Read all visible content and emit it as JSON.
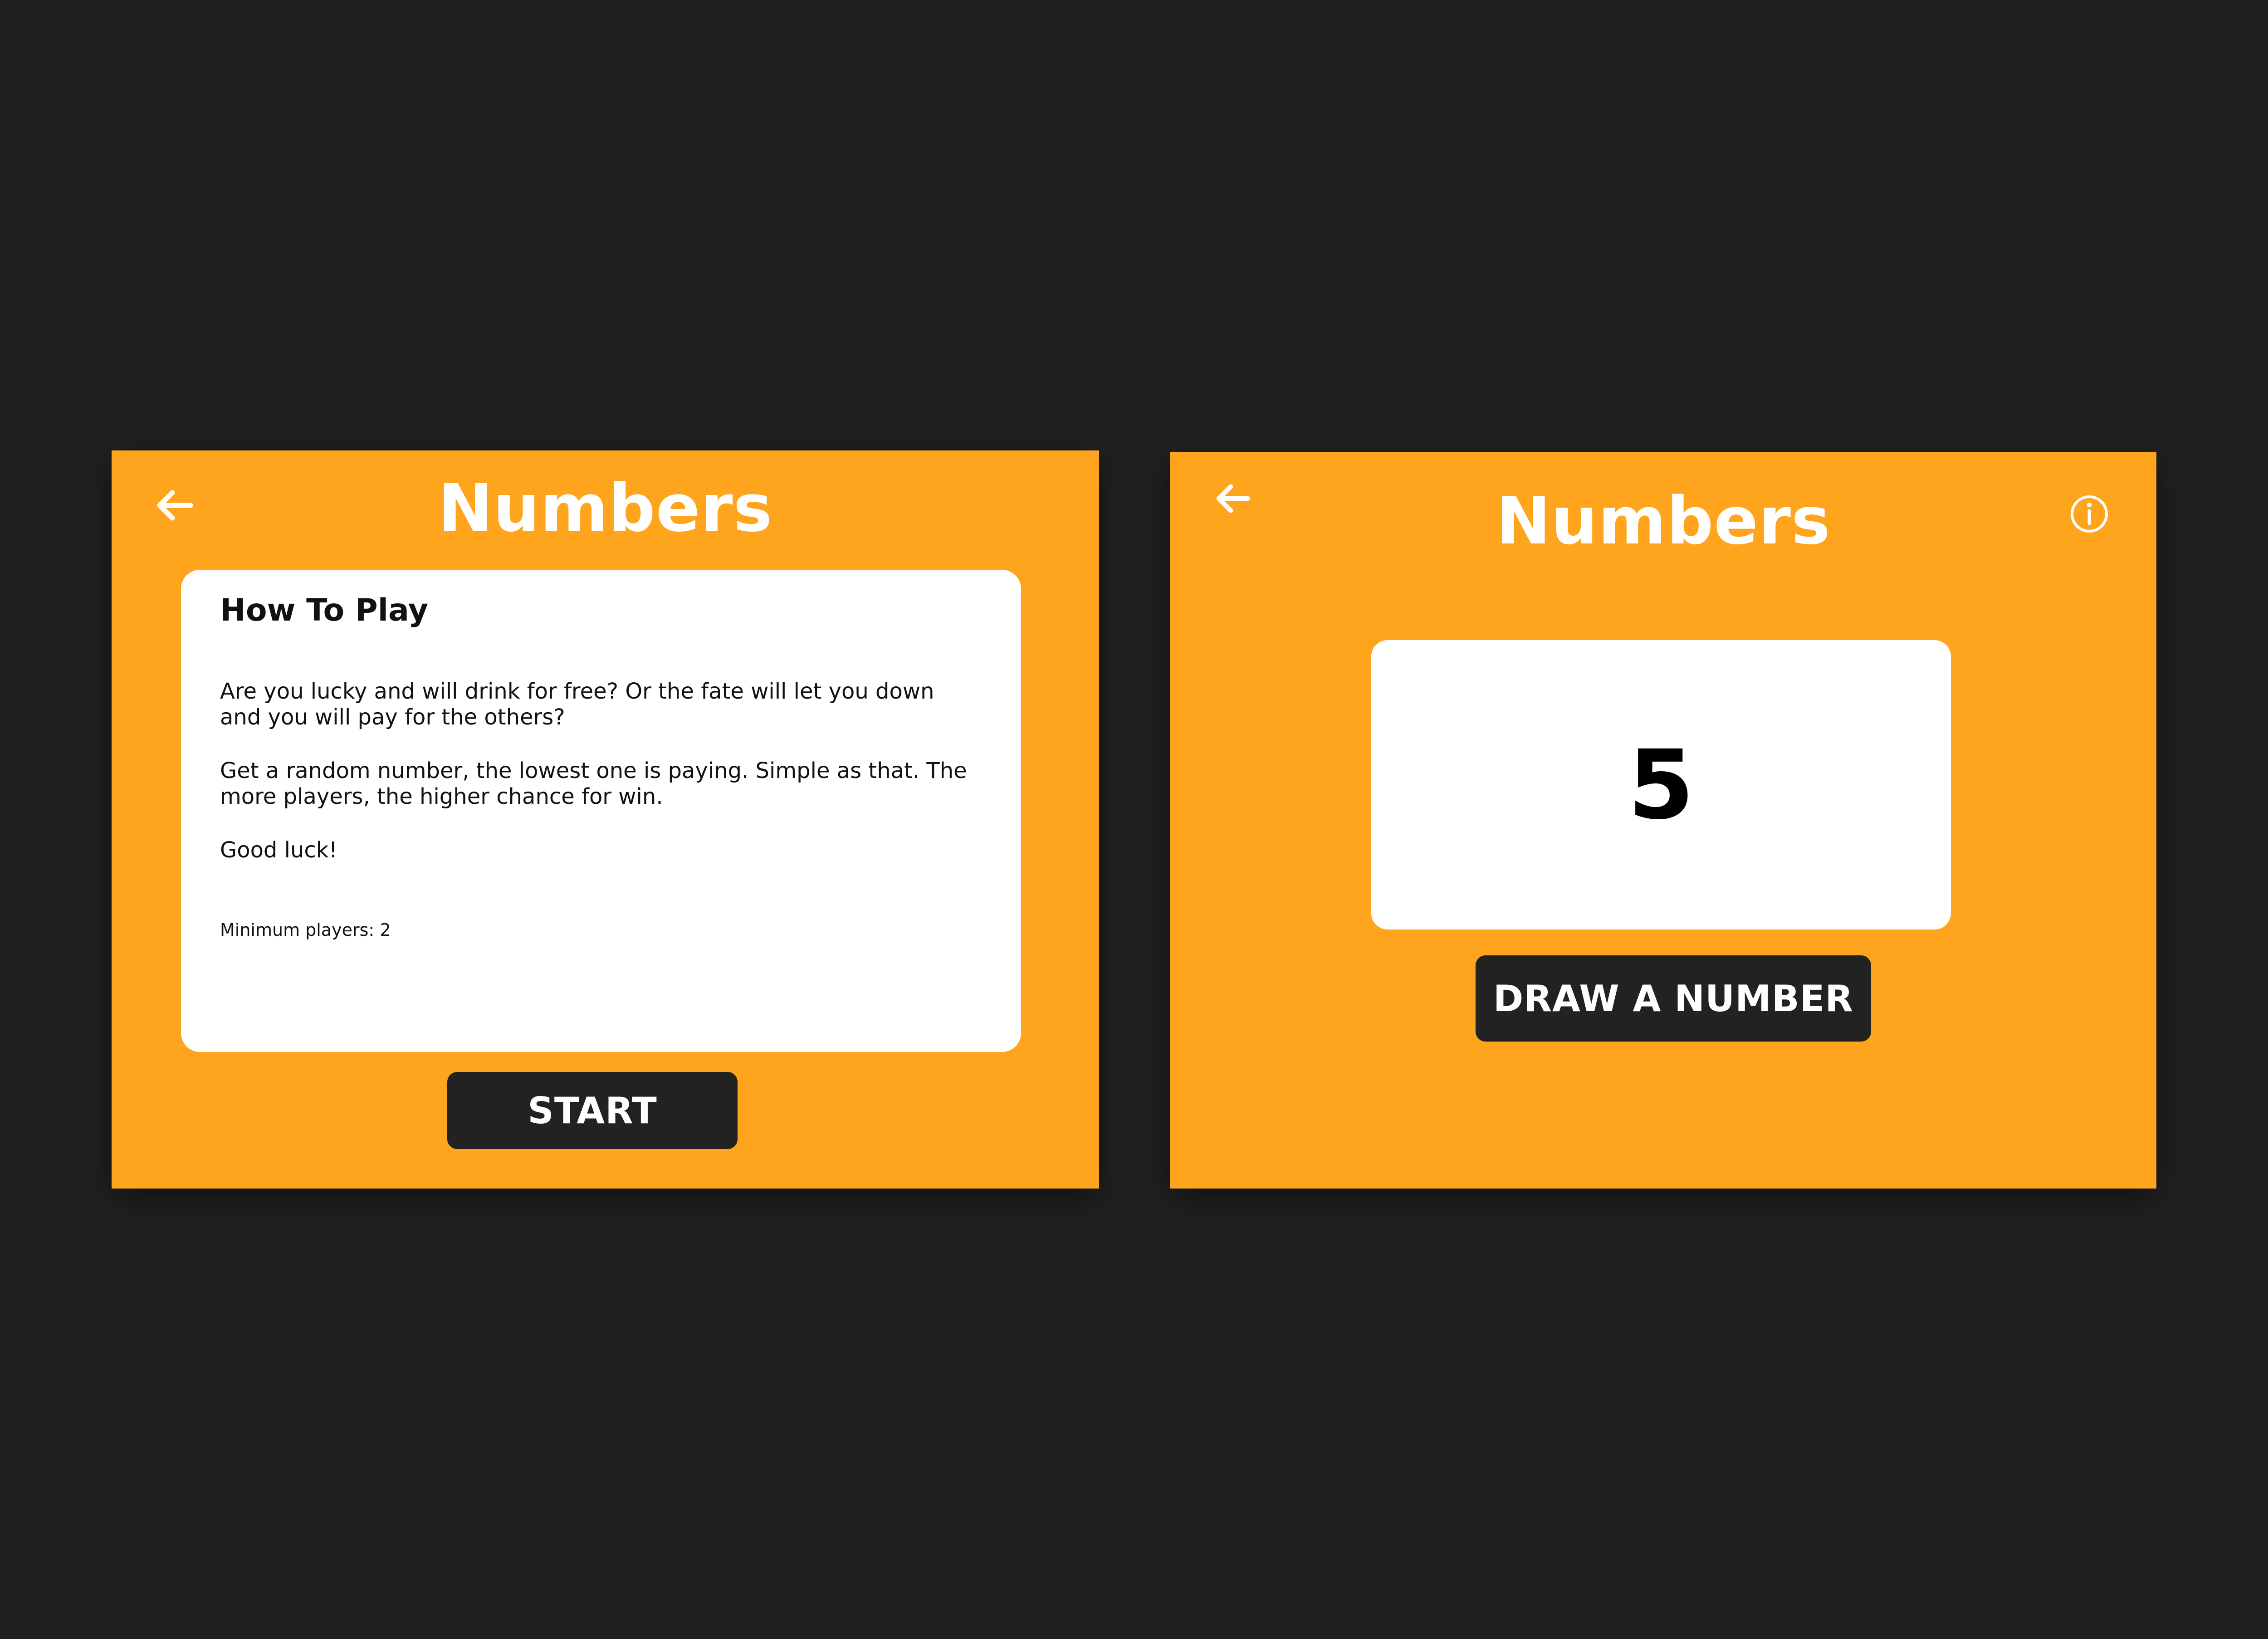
{
  "colors": {
    "background": "#202020",
    "accent": "#FFA41D",
    "card": "#FFFFFF",
    "button": "#222222",
    "button_text": "#FFFFFF",
    "title_text": "#FFFFFF"
  },
  "left_screen": {
    "back_icon": "arrow-left-icon",
    "title": "Numbers",
    "card": {
      "heading": "How To Play",
      "paragraphs": [
        "Are you lucky and will drink for free? Or the fate will let you down and you will pay for the others?",
        "Get a random number, the lowest one is paying. Simple as that. The more players, the higher chance for win.",
        "Good luck!"
      ],
      "min_players": "Minimum players: 2"
    },
    "start_label": "START"
  },
  "right_screen": {
    "back_icon": "arrow-left-icon",
    "title": "Numbers",
    "info_icon": "info-circle-icon",
    "number": "5",
    "draw_label": "DRAW A NUMBER"
  }
}
